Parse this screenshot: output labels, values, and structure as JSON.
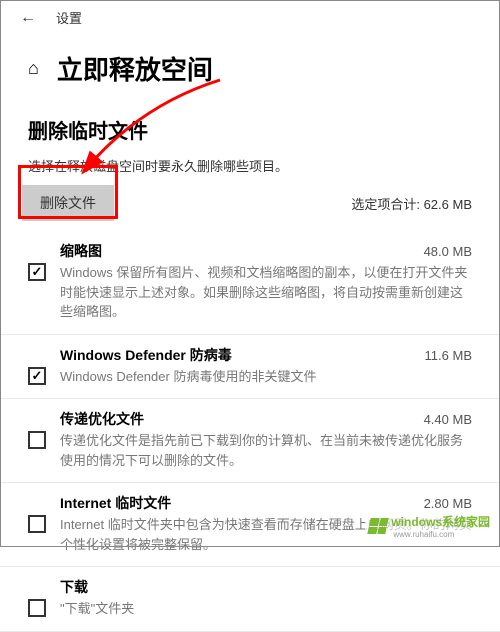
{
  "header": {
    "settings_label": "设置"
  },
  "title": "立即释放空间",
  "section": {
    "heading": "删除临时文件",
    "description": "选择在释放磁盘空间时要永久删除哪些项目。"
  },
  "action": {
    "delete_label": "删除文件",
    "total_prefix": "选定项合计:",
    "total_value": "62.6 MB"
  },
  "items": [
    {
      "title": "缩略图",
      "size": "48.0 MB",
      "desc": "Windows 保留所有图片、视频和文档缩略图的副本，以便在打开文件夹时能快速显示上述对象。如果删除这些缩略图，将自动按需重新创建这些缩略图。",
      "checked": true
    },
    {
      "title": "Windows Defender 防病毒",
      "size": "11.6 MB",
      "desc": "Windows Defender 防病毒使用的非关键文件",
      "checked": true
    },
    {
      "title": "传递优化文件",
      "size": "4.40 MB",
      "desc": "传递优化文件是指先前已下载到你的计算机、在当前未被传递优化服务使用的情况下可以删除的文件。",
      "checked": false
    },
    {
      "title": "Internet 临时文件",
      "size": "2.80 MB",
      "desc": "Internet 临时文件夹中包含为快速查看而存储在硬盘上的网页。你的网页个性化设置将被完整保留。",
      "checked": false
    },
    {
      "title": "下载",
      "size": "",
      "desc": "\"下载\"文件夹",
      "checked": false
    }
  ],
  "watermark": {
    "text": "windows系统家园",
    "sub": "www.ruhaifu.com"
  }
}
